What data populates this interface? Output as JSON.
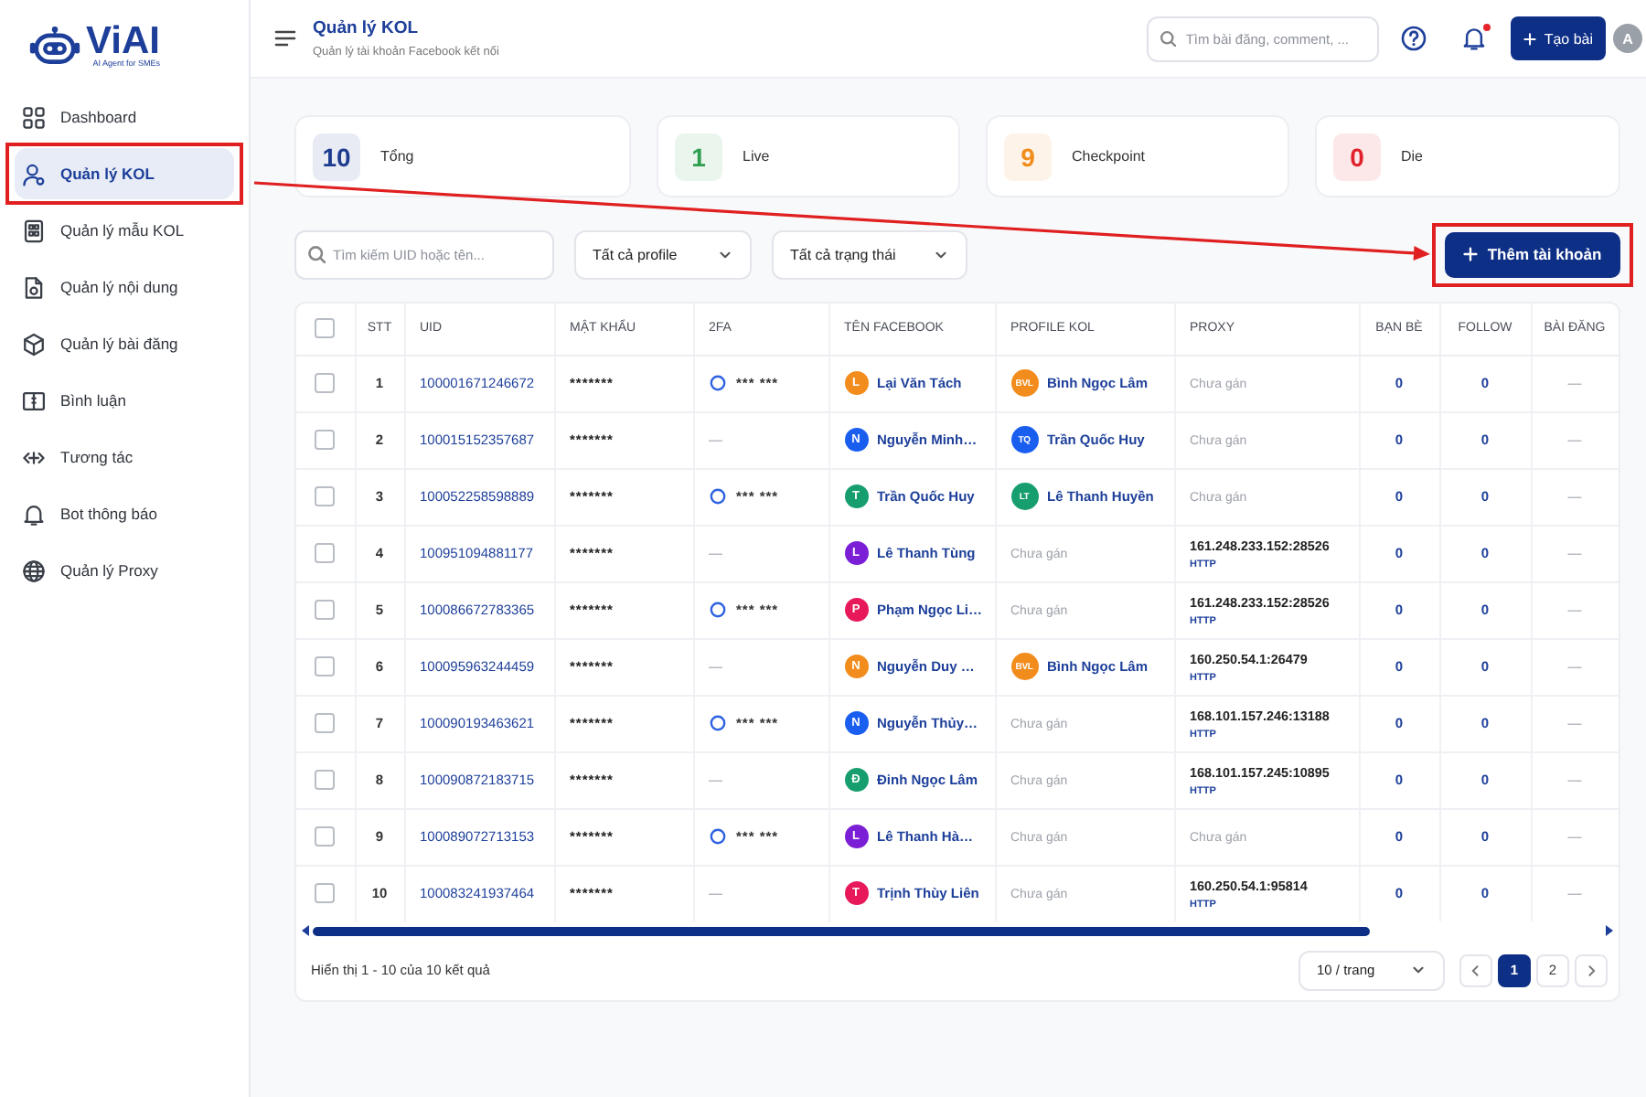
{
  "sidebar": {
    "logo": {
      "name": "ViAI",
      "tagline": "AI Agent for SMEs"
    },
    "items": [
      {
        "label": "Dashboard",
        "selected": false,
        "highlighted": false
      },
      {
        "label": "Quản lý KOL",
        "selected": true,
        "highlighted": true
      },
      {
        "label": "Quản lý mẫu KOL",
        "selected": false,
        "highlighted": false
      },
      {
        "label": "Quản lý nội dung",
        "selected": false,
        "highlighted": false
      },
      {
        "label": "Quản lý bài đăng",
        "selected": false,
        "highlighted": false
      },
      {
        "label": "Bình luận",
        "selected": false,
        "highlighted": false
      },
      {
        "label": "Tương tác",
        "selected": false,
        "highlighted": false
      },
      {
        "label": "Bot thông báo",
        "selected": false,
        "highlighted": false
      },
      {
        "label": "Quản lý Proxy",
        "selected": false,
        "highlighted": false
      }
    ]
  },
  "header": {
    "title": "Quản lý KOL",
    "subtitle": "Quản lý tài khoản Facebook kết nối",
    "search": {
      "placeholder": "Tìm bài đăng, comment, ..."
    },
    "notifications": {
      "unread": true
    },
    "create_button": "Tạo bài",
    "avatar": "A"
  },
  "stats": [
    {
      "value": "10",
      "label": "Tổng",
      "color": "#1d3b8f"
    },
    {
      "value": "1",
      "label": "Live",
      "color": "#2e9e4f"
    },
    {
      "value": "9",
      "label": "Checkpoint",
      "color": "#f08c1a"
    },
    {
      "value": "0",
      "label": "Die",
      "color": "#e0202a"
    }
  ],
  "filters": {
    "search": {
      "placeholder": "Tìm kiếm UID hoặc tên..."
    },
    "selects": [
      {
        "value": "Tất cả profile"
      },
      {
        "value": "Tất cả trạng thái"
      }
    ]
  },
  "add_button": {
    "label": "Thêm tài khoản",
    "highlighted": true
  },
  "table": {
    "select_all": {
      "checked": false
    },
    "columns": [
      "STT",
      "UID",
      "MẬT KHẨU",
      "2FA",
      "TÊN FACEBOOK",
      "PROFILE KOL",
      "PROXY",
      "BẠN BÈ",
      "FOLLOW",
      "BÀI ĐĂNG"
    ],
    "rows": [
      {
        "checked": false,
        "stt": "1",
        "uid": "100001671246672",
        "password": "*******",
        "twofa": {
          "enabled": true,
          "text": "*** ***"
        },
        "facebook": {
          "initial": "L",
          "name": "Lại Văn Tách",
          "color": "#f28c1c"
        },
        "profile": {
          "kind": "kol",
          "initials": "BVL",
          "name": "Bình Ngọc Lâm",
          "color": "#f28c1c"
        },
        "proxy": {
          "kind": "none",
          "text": "Chưa gán"
        },
        "friends": "0",
        "follow": "0",
        "posts": "—"
      },
      {
        "checked": false,
        "stt": "2",
        "uid": "100015152357687",
        "password": "*******",
        "twofa": {
          "enabled": false,
          "text": "—"
        },
        "facebook": {
          "initial": "N",
          "name": "Nguyễn Minh…",
          "color": "#1a5ef0"
        },
        "profile": {
          "kind": "kol",
          "initials": "TQ",
          "name": "Trần Quốc Huy",
          "color": "#1a5ef0"
        },
        "proxy": {
          "kind": "none",
          "text": "Chưa gán"
        },
        "friends": "0",
        "follow": "0",
        "posts": "—"
      },
      {
        "checked": false,
        "stt": "3",
        "uid": "100052258598889",
        "password": "*******",
        "twofa": {
          "enabled": true,
          "text": "*** ***"
        },
        "facebook": {
          "initial": "T",
          "name": "Trần Quốc Huy",
          "color": "#179e6e"
        },
        "profile": {
          "kind": "kol",
          "initials": "LT",
          "name": "Lê Thanh Huyền",
          "color": "#179e6e"
        },
        "proxy": {
          "kind": "none",
          "text": "Chưa gán"
        },
        "friends": "0",
        "follow": "0",
        "posts": "—"
      },
      {
        "checked": false,
        "stt": "4",
        "uid": "100951094881177",
        "password": "*******",
        "twofa": {
          "enabled": false,
          "text": "—"
        },
        "facebook": {
          "initial": "L",
          "name": "Lê Thanh Tùng",
          "color": "#7b1fd6"
        },
        "profile": {
          "kind": "none",
          "text": "Chưa gán"
        },
        "proxy": {
          "kind": "proxy",
          "address": "161.248.233.152:28526",
          "protocol": "HTTP"
        },
        "friends": "0",
        "follow": "0",
        "posts": "—"
      },
      {
        "checked": false,
        "stt": "5",
        "uid": "100086672783365",
        "password": "*******",
        "twofa": {
          "enabled": true,
          "text": "*** ***"
        },
        "facebook": {
          "initial": "P",
          "name": "Phạm Ngọc Li…",
          "color": "#e8195a"
        },
        "profile": {
          "kind": "none",
          "text": "Chưa gán"
        },
        "proxy": {
          "kind": "proxy",
          "address": "161.248.233.152:28526",
          "protocol": "HTTP"
        },
        "friends": "0",
        "follow": "0",
        "posts": "—"
      },
      {
        "checked": false,
        "stt": "6",
        "uid": "100095963244459",
        "password": "*******",
        "twofa": {
          "enabled": false,
          "text": "—"
        },
        "facebook": {
          "initial": "N",
          "name": "Nguyễn Duy …",
          "color": "#f28c1c"
        },
        "profile": {
          "kind": "kol",
          "initials": "BVL",
          "name": "Bình Ngọc Lâm",
          "color": "#f28c1c"
        },
        "proxy": {
          "kind": "proxy",
          "address": "160.250.54.1:26479",
          "protocol": "HTTP"
        },
        "friends": "0",
        "follow": "0",
        "posts": "—"
      },
      {
        "checked": false,
        "stt": "7",
        "uid": "100090193463621",
        "password": "*******",
        "twofa": {
          "enabled": true,
          "text": "*** ***"
        },
        "facebook": {
          "initial": "N",
          "name": "Nguyễn Thủy…",
          "color": "#1a5ef0"
        },
        "profile": {
          "kind": "none",
          "text": "Chưa gán"
        },
        "proxy": {
          "kind": "proxy",
          "address": "168.101.157.246:13188",
          "protocol": "HTTP"
        },
        "friends": "0",
        "follow": "0",
        "posts": "—"
      },
      {
        "checked": false,
        "stt": "8",
        "uid": "100090872183715",
        "password": "*******",
        "twofa": {
          "enabled": false,
          "text": "—"
        },
        "facebook": {
          "initial": "Đ",
          "name": "Đinh Ngọc Lâm",
          "color": "#179e6e"
        },
        "profile": {
          "kind": "none",
          "text": "Chưa gán"
        },
        "proxy": {
          "kind": "proxy",
          "address": "168.101.157.245:10895",
          "protocol": "HTTP"
        },
        "friends": "0",
        "follow": "0",
        "posts": "—"
      },
      {
        "checked": false,
        "stt": "9",
        "uid": "100089072713153",
        "password": "*******",
        "twofa": {
          "enabled": true,
          "text": "*** ***"
        },
        "facebook": {
          "initial": "L",
          "name": "Lê Thanh Hà…",
          "color": "#7b1fd6"
        },
        "profile": {
          "kind": "none",
          "text": "Chưa gán"
        },
        "proxy": {
          "kind": "none",
          "text": "Chưa gán"
        },
        "friends": "0",
        "follow": "0",
        "posts": "—"
      },
      {
        "checked": false,
        "stt": "10",
        "uid": "100083241937464",
        "password": "*******",
        "twofa": {
          "enabled": false,
          "text": "—"
        },
        "facebook": {
          "initial": "T",
          "name": "Trịnh Thùy Liên",
          "color": "#e8195a"
        },
        "profile": {
          "kind": "none",
          "text": "Chưa gán"
        },
        "proxy": {
          "kind": "proxy",
          "address": "160.250.54.1:95814",
          "protocol": "HTTP"
        },
        "friends": "0",
        "follow": "0",
        "posts": "—"
      }
    ]
  },
  "footer": {
    "summary": "Hiển thị 1 - 10 của 10 kết quả",
    "page_size": "10 / trang",
    "pages": [
      {
        "label": "1",
        "selected": true
      },
      {
        "label": "2",
        "selected": false
      }
    ]
  }
}
